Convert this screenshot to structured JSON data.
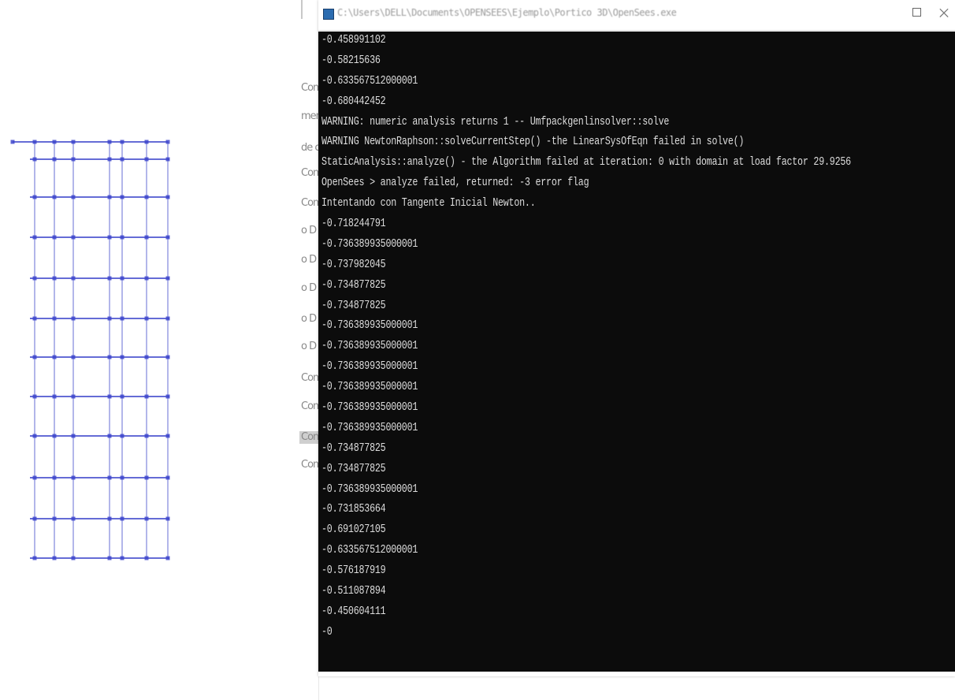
{
  "console": {
    "title": "C:\\Users\\DELL\\Documents\\OPENSEES\\Ejemplo\\Portico 3D\\OpenSees.exe",
    "lines": [
      "-0.458991102",
      "-0.58215636",
      "-0.633567512000001",
      "-0.680442452",
      "WARNING: numeric analysis returns 1 -- Umfpackgenlinsolver::solve",
      "WARNING NewtonRaphson::solveCurrentStep() -the LinearSysOfEqn failed in solve()",
      "StaticAnalysis::analyze() - the Algorithm failed at iteration: 0 with domain at load factor 29.9256",
      "OpenSees > analyze failed, returned: -3 error flag",
      "Intentando con Tangente Inicial Newton..",
      "-0.718244791",
      "-0.736389935000001",
      "-0.737982045",
      "-0.734877825",
      "-0.734877825",
      "-0.736389935000001",
      "-0.736389935000001",
      "-0.736389935000001",
      "-0.736389935000001",
      "-0.736389935000001",
      "-0.736389935000001",
      "-0.734877825",
      "-0.734877825",
      "-0.736389935000001",
      "-0.731853664",
      "-0.691027105",
      "-0.633567512000001",
      "-0.576187919",
      "-0.511087894",
      "-0.450604111",
      "-0"
    ]
  },
  "background_window": {
    "fragments": [
      "Com",
      "men",
      "de c",
      "Com",
      "Com",
      "o D",
      "o D",
      "o D",
      "o D",
      "o D",
      "Com",
      "Com",
      "Con",
      "Com"
    ]
  },
  "colors": {
    "console_bg": "#0c0c0c",
    "console_text": "#dedede",
    "frame_line": "#3f48cc"
  },
  "icons": {
    "app": "console-app-icon",
    "maximize": "maximize-icon",
    "close": "close-icon"
  }
}
